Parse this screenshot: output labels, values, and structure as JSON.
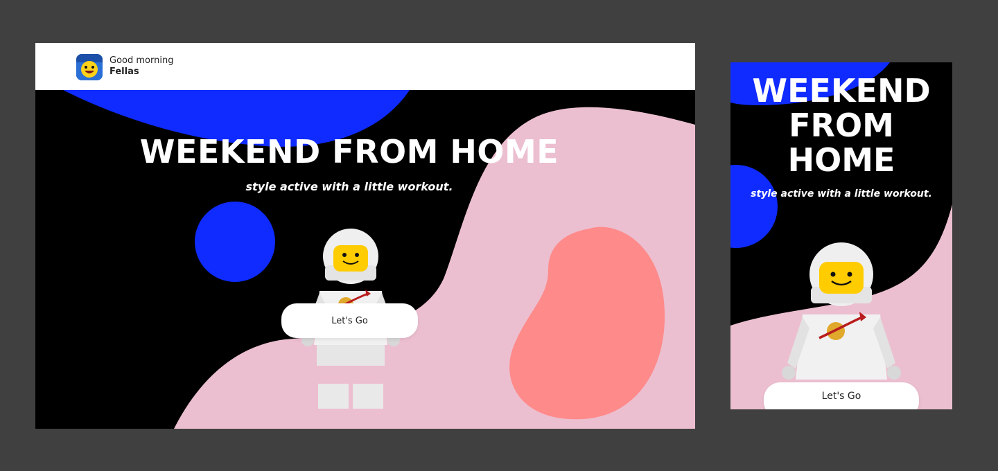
{
  "colors": {
    "background": "#404040",
    "hero_black": "#000000",
    "blue": "#0f2bff",
    "pink": "#ecbfd0",
    "coral": "#ff8a8a",
    "white": "#ffffff"
  },
  "header": {
    "greeting": "Good morning",
    "name": "Fellas",
    "avatar_icon": "lego-face-icon"
  },
  "hero": {
    "title": "WEEKEND FROM HOME",
    "subtitle": "style active with a little workout.",
    "cta_label": "Let's Go",
    "figure_icon": "lego-astronaut"
  },
  "mobile": {
    "title_line1": "WEEKEND",
    "title_line2": "FROM",
    "title_line3": "HOME",
    "subtitle": "style active with a little workout.",
    "cta_label": "Let's Go"
  }
}
